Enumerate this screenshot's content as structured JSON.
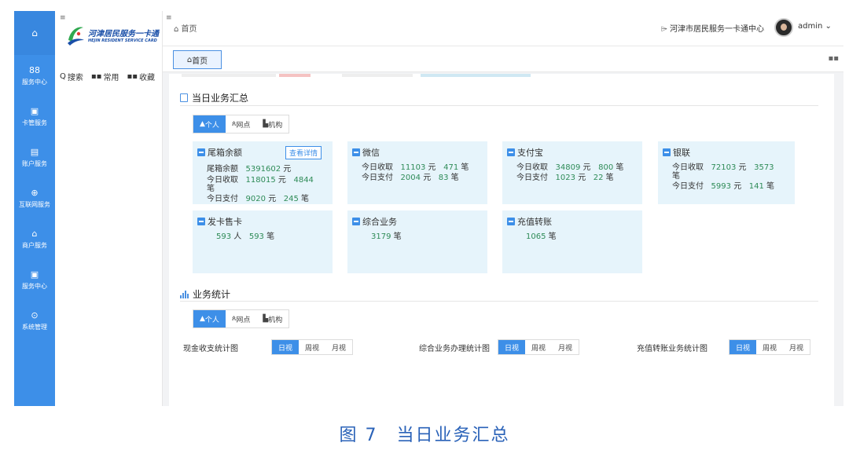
{
  "rail": {
    "items": [
      {
        "icon": "88",
        "label": "服务中心"
      },
      {
        "icon": "▣",
        "label": "卡管服务"
      },
      {
        "icon": "▤",
        "label": "账户服务"
      },
      {
        "icon": "⊕",
        "label": "互联网服务"
      },
      {
        "icon": "⌂",
        "label": "商户服务"
      },
      {
        "icon": "▣",
        "label": "服务中心"
      },
      {
        "icon": "⊙",
        "label": "系统管理"
      }
    ]
  },
  "logo": {
    "cn": "河津居民服务一卡通",
    "en": "HEJIN RESIDENT SERVICE CARD"
  },
  "quick": {
    "search": "搜索",
    "common": "常用",
    "favorite": "收藏"
  },
  "header": {
    "breadcrumb": "首页",
    "org": "河津市居民服务一卡通中心",
    "user": "admin"
  },
  "tabs": {
    "home": "首页"
  },
  "summary": {
    "title": "当日业务汇总",
    "segments": [
      "个人",
      "网点",
      "机构"
    ],
    "cards": {
      "cash": {
        "title": "尾箱余额",
        "detail": "查看详情",
        "rows": [
          {
            "label": "尾箱余额",
            "amount": "5391602",
            "unit": "元"
          },
          {
            "label": "今日收取",
            "amount": "118015",
            "unit": "元",
            "count": "4844",
            "count_unit": "笔"
          },
          {
            "label": "今日支付",
            "amount": "9020",
            "unit": "元",
            "count": "245",
            "count_unit": "笔"
          }
        ]
      },
      "wechat": {
        "title": "微信",
        "rows": [
          {
            "label": "今日收取",
            "amount": "11103",
            "unit": "元",
            "count": "471",
            "count_unit": "笔"
          },
          {
            "label": "今日支付",
            "amount": "2004",
            "unit": "元",
            "count": "83",
            "count_unit": "笔"
          }
        ]
      },
      "alipay": {
        "title": "支付宝",
        "rows": [
          {
            "label": "今日收取",
            "amount": "34809",
            "unit": "元",
            "count": "800",
            "count_unit": "笔"
          },
          {
            "label": "今日支付",
            "amount": "1023",
            "unit": "元",
            "count": "22",
            "count_unit": "笔"
          }
        ]
      },
      "unionpay": {
        "title": "银联",
        "rows": [
          {
            "label": "今日收取",
            "amount": "72103",
            "unit": "元",
            "count": "3573",
            "count_unit": "笔"
          },
          {
            "label": "今日支付",
            "amount": "5993",
            "unit": "元",
            "count": "141",
            "count_unit": "笔"
          }
        ]
      },
      "card_issue": {
        "title": "发卡售卡",
        "people": "593",
        "people_unit": "人",
        "count": "593",
        "count_unit": "笔"
      },
      "composite": {
        "title": "综合业务",
        "count": "3179",
        "count_unit": "笔"
      },
      "recharge": {
        "title": "充值转账",
        "count": "1065",
        "count_unit": "笔"
      }
    }
  },
  "stats": {
    "title": "业务统计",
    "segments": [
      "个人",
      "网点",
      "机构"
    ],
    "charts": [
      {
        "label": "现金收支统计图",
        "options": [
          "日视",
          "周视",
          "月视"
        ]
      },
      {
        "label": "综合业务办理统计图",
        "options": [
          "日视",
          "周视",
          "月视"
        ]
      },
      {
        "label": "充值转账业务统计图",
        "options": [
          "日视",
          "周视",
          "月视"
        ]
      }
    ]
  },
  "caption": "图 7　当日业务汇总"
}
